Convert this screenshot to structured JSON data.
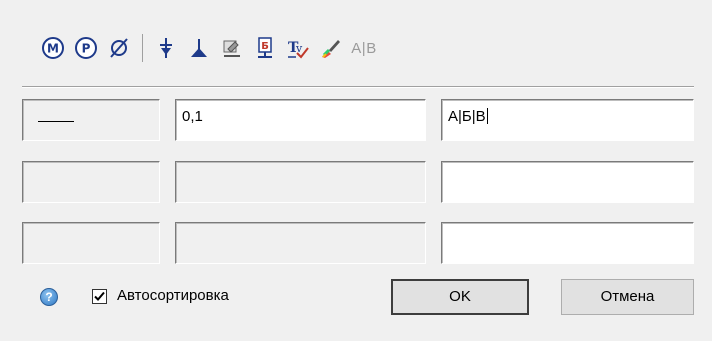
{
  "toolbar": {
    "icons": [
      "M-circled-icon",
      "P-circled-icon",
      "diameter-icon",
      "arrow-down-icon",
      "perpendicular-icon",
      "symbol-icon",
      "b-marker-icon",
      "tv-check-icon",
      "brush-icon"
    ],
    "text_button": "A|B"
  },
  "rows": [
    {
      "line_style": "solid",
      "value": "0,1",
      "text": "А|Б|В"
    },
    {
      "line_style": "",
      "value": "",
      "text": ""
    },
    {
      "line_style": "",
      "value": "",
      "text": ""
    }
  ],
  "footer": {
    "help": "?",
    "autosort_label": "Автосортировка",
    "autosort_checked": true,
    "ok_label": "OK",
    "cancel_label": "Отмена"
  }
}
